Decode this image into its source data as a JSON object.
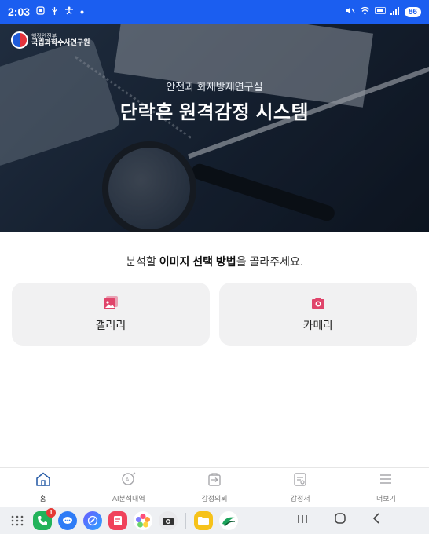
{
  "status_bar": {
    "time": "2:03",
    "battery": "86",
    "left_icons": [
      "screenshot-icon",
      "usb-icon",
      "accessibility-icon",
      "dot-icon"
    ],
    "right_icons": [
      "mute-icon",
      "wifi-icon",
      "lte-icon",
      "signal-icon"
    ]
  },
  "header": {
    "org_sub": "행정안전부",
    "org_name": "국립과학수사연구원",
    "subtitle": "안전과 화재방재연구실",
    "title": "단락흔 원격감정 시스템"
  },
  "prompt": {
    "before": "분석할 ",
    "emphasis": "이미지 선택 방법",
    "after": "을 골라주세요."
  },
  "options": {
    "gallery": {
      "label": "갤러리",
      "icon": "gallery-icon"
    },
    "camera": {
      "label": "카메라",
      "icon": "camera-icon"
    }
  },
  "bottom_nav": {
    "items": [
      {
        "label": "홈",
        "icon": "home-icon",
        "active": true
      },
      {
        "label": "AI분석내역",
        "icon": "ai-history-icon",
        "active": false
      },
      {
        "label": "감정의뢰",
        "icon": "request-icon",
        "active": false
      },
      {
        "label": "감정서",
        "icon": "report-icon",
        "active": false
      },
      {
        "label": "더보기",
        "icon": "menu-icon",
        "active": false
      }
    ]
  },
  "dock": {
    "phone_badge": "1",
    "apps": [
      "apps-grid-icon",
      "phone-icon",
      "messages-icon",
      "browser-icon",
      "notes-icon",
      "gallery-app-icon",
      "camera-app-icon",
      "files-icon",
      "naver-icon"
    ]
  },
  "colors": {
    "status_bar": "#1b5ef0",
    "accent_icon": "#e0456b",
    "card_bg": "#f1f1f2"
  }
}
